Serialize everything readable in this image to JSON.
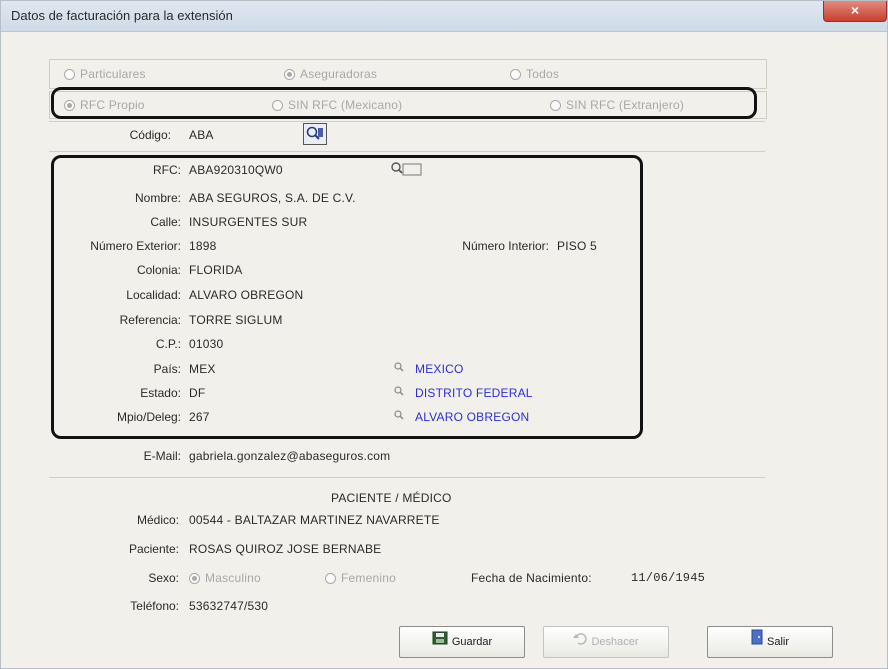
{
  "window": {
    "title": "Datos de facturación para la extensión",
    "close_label": "×"
  },
  "filter_type": {
    "options": [
      "Particulares",
      "Aseguradoras",
      "Todos"
    ],
    "selected": "Aseguradoras"
  },
  "rfc_type": {
    "options": [
      "RFC Propio",
      "SIN RFC (Mexicano)",
      "SIN RFC (Extranjero)"
    ],
    "selected": "RFC Propio"
  },
  "codigo": {
    "label": "Código:",
    "value": "ABA"
  },
  "address": {
    "rfc": {
      "label": "RFC:",
      "value": "ABA920310QW0"
    },
    "nombre": {
      "label": "Nombre:",
      "value": "ABA SEGUROS, S.A. DE C.V."
    },
    "calle": {
      "label": "Calle:",
      "value": "INSURGENTES SUR"
    },
    "numero_exterior": {
      "label": "Número Exterior:",
      "value": "1898"
    },
    "numero_interior": {
      "label": "Número Interior:",
      "value": "PISO 5"
    },
    "colonia": {
      "label": "Colonia:",
      "value": "FLORIDA"
    },
    "localidad": {
      "label": "Localidad:",
      "value": "ALVARO OBREGON"
    },
    "referencia": {
      "label": "Referencia:",
      "value": "TORRE SIGLUM"
    },
    "cp": {
      "label": "C.P.:",
      "value": "01030"
    },
    "pais": {
      "label": "País:",
      "value": "MEX",
      "name": "MEXICO"
    },
    "estado": {
      "label": "Estado:",
      "value": "DF",
      "name": "DISTRITO FEDERAL"
    },
    "municipio": {
      "label": "Mpio/Deleg:",
      "value": "267",
      "name": "ALVARO OBREGON"
    }
  },
  "email": {
    "label": "E-Mail:",
    "value": "gabriela.gonzalez@abaseguros.com"
  },
  "patient_section": {
    "heading": "PACIENTE / MÉDICO",
    "medico": {
      "label": "Médico:",
      "value": "00544 - BALTAZAR MARTINEZ NAVARRETE"
    },
    "paciente": {
      "label": "Paciente:",
      "value": "ROSAS QUIROZ JOSE BERNABE"
    },
    "sexo": {
      "label": "Sexo:",
      "options": [
        "Masculino",
        "Femenino"
      ],
      "selected": "Masculino"
    },
    "fecha_nacimiento": {
      "label": "Fecha de Nacimiento:",
      "value": "11/06/1945"
    },
    "telefono": {
      "label": "Teléfono:",
      "value": "53632747/530"
    }
  },
  "buttons": {
    "guardar": "Guardar",
    "deshacer": "Deshacer",
    "salir": "Salir"
  },
  "colors": {
    "link_blue": "#2d2ddb",
    "highlight_border": "#121212",
    "close_red": "#c8402f"
  }
}
